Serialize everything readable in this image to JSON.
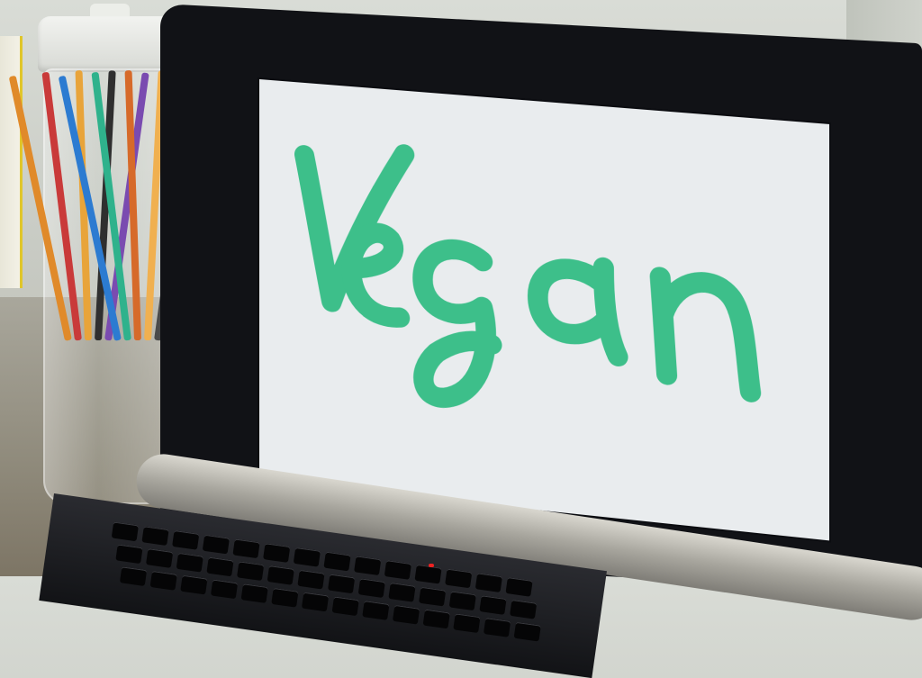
{
  "scene": {
    "subject": "laptop-display",
    "handwritten_word": "Vegan",
    "ink_color": "#3dbf8a",
    "screen_color": "#e9ecee",
    "bezel_color": "#111216",
    "jar_pens": [
      "#e08a2a",
      "#c93a3a",
      "#e8a43a",
      "#2f2f2f",
      "#7a4bb0",
      "#2c7bd1",
      "#2fb28c",
      "#d66a2a",
      "#f0b050",
      "#4a4a4a"
    ]
  }
}
